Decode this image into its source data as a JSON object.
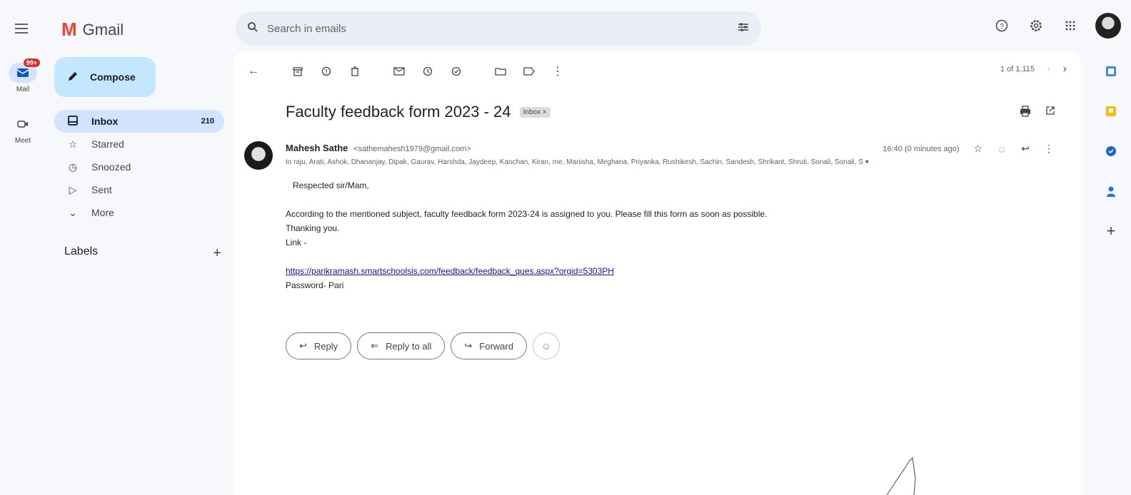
{
  "rail": {
    "mail_label": "Mail",
    "mail_badge": "99+",
    "meet_label": "Meet"
  },
  "brand": {
    "logo_letter": "M",
    "name": "Gmail"
  },
  "compose": {
    "label": "Compose"
  },
  "nav": [
    {
      "icon": "inbox-icon",
      "label": "Inbox",
      "count": "210",
      "active": true
    },
    {
      "icon": "star-icon",
      "label": "Starred",
      "count": ""
    },
    {
      "icon": "clock-icon",
      "label": "Snoozed",
      "count": ""
    },
    {
      "icon": "send-icon",
      "label": "Sent",
      "count": ""
    },
    {
      "icon": "chevron-down-icon",
      "label": "More",
      "count": ""
    }
  ],
  "labels": {
    "title": "Labels",
    "add": "+"
  },
  "search": {
    "placeholder": "Search in emails"
  },
  "toolbar": {
    "pager_text": "1 of 1,115"
  },
  "email": {
    "subject": "Faculty feedback form 2023 - 24",
    "tag": "Inbox ×",
    "sender_name": "Mahesh Sathe",
    "sender_email": "<sathemahesh1979@gmail.com>",
    "to_line": "to raju, Arati, Ashok, Dhananjay, Dipak, Gaurav, Harshda, Jaydeep, Kanchan, Kiran, me, Manisha, Meghana, Priyanka, Rushikesh, Sachin, Sandesh, Shrikant, Shruti, Sonali, Sonali, S",
    "time": "16:40 (0 minutes ago)",
    "greeting": "Respected sir/Mam,",
    "line1": "According to the mentioned subject, faculty feedback form 2023-24 is assigned to you. Please fill this form as soon as possible.",
    "line2": "Thanking you.",
    "line3": "Link -",
    "link": "https://parikramash.smartschoolsis.com/feedback/feedback_ques.aspx?orgid=5303PH",
    "password": "Password- Pari"
  },
  "actions": {
    "reply": "Reply",
    "reply_all": "Reply to all",
    "forward": "Forward"
  }
}
